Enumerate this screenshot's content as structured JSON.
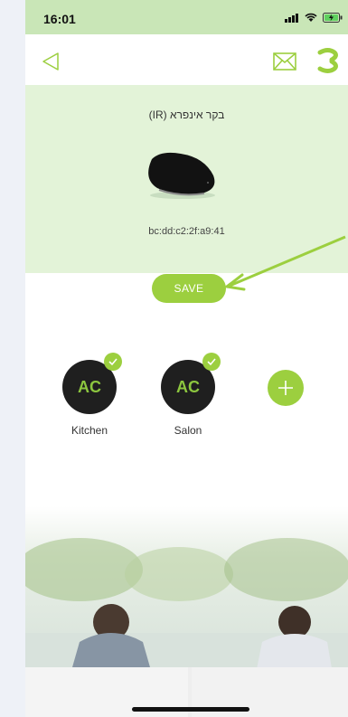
{
  "status_bar": {
    "time": "16:01"
  },
  "nav": {
    "back_icon": "back-triangle-icon",
    "mail_icon": "envelope-icon",
    "logo_icon": "app-logo-icon"
  },
  "device": {
    "name": "בקר אינפרא (IR)",
    "mac": "bc:dd:c2:2f:a9:41"
  },
  "actions": {
    "save_label": "SAVE"
  },
  "rooms": [
    {
      "badge": "AC",
      "name": "Kitchen",
      "selected": true
    },
    {
      "badge": "AC",
      "name": "Salon",
      "selected": true
    }
  ],
  "colors": {
    "accent": "#9ccf3f",
    "panel": "#e3f3d8",
    "status_bar": "#c9e6b7",
    "ac_text": "#8cc63f"
  }
}
